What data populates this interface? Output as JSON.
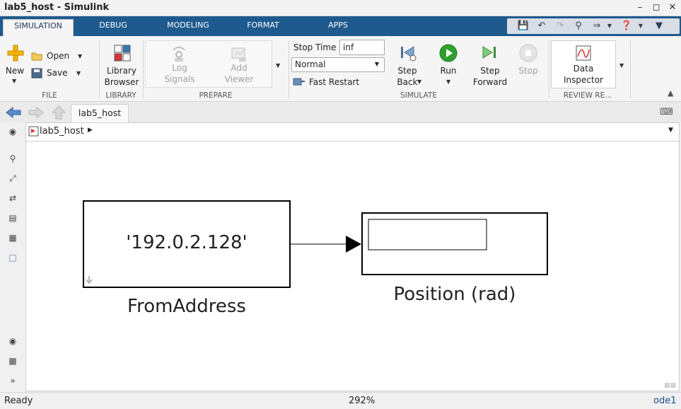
{
  "window": {
    "title": "lab5_host - Simulink"
  },
  "tabs": [
    {
      "label": "SIMULATION",
      "active": true
    },
    {
      "label": "DEBUG",
      "active": false
    },
    {
      "label": "MODELING",
      "active": false
    },
    {
      "label": "FORMAT",
      "active": false
    },
    {
      "label": "APPS",
      "active": false
    }
  ],
  "file": {
    "new_label": "New",
    "open_label": "Open",
    "save_label": "Save",
    "group_label": "FILE"
  },
  "library": {
    "line1": "Library",
    "line2": "Browser",
    "group_label": "LIBRARY"
  },
  "prepare": {
    "log_signals_1": "Log",
    "log_signals_2": "Signals",
    "add_viewer_1": "Add",
    "add_viewer_2": "Viewer",
    "group_label": "PREPARE"
  },
  "simulate": {
    "stop_time_label": "Stop Time",
    "stop_time_value": "inf",
    "mode_value": "Normal",
    "fast_restart_label": "Fast Restart",
    "step_back_1": "Step",
    "step_back_2": "Back",
    "run_label": "Run",
    "step_forward_1": "Step",
    "step_forward_2": "Forward",
    "stop_label": "Stop",
    "group_label": "SIMULATE"
  },
  "review": {
    "inspector_1": "Data",
    "inspector_2": "Inspector",
    "group_label": "REVIEW RE..."
  },
  "nav": {
    "model_tab": "lab5_host"
  },
  "address": {
    "path": "lab5_host"
  },
  "diagram": {
    "from_block_text": "'192.0.2.128'",
    "from_block_name": "FromAddress",
    "display_block_name": "Position (rad)"
  },
  "status": {
    "state": "Ready",
    "zoom": "292%",
    "solver": "ode1"
  },
  "colors": {
    "tab_bar": "#1e5a8e",
    "run_green": "#2fa02f",
    "accent_blue": "#3b73b9"
  }
}
